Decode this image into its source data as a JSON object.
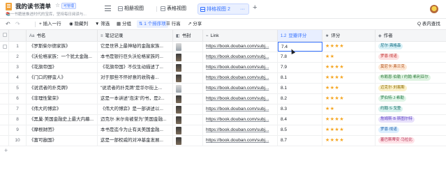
{
  "header": {
    "title": "我的读书清单",
    "star_icon": "star-outline-icon",
    "badge": "可管理",
    "subtitle": "📚一书籍是推进时代的宝库，坚持每日阅读与..."
  },
  "tabs": [
    {
      "label": "相册视图",
      "icon": "table-view-icon"
    },
    {
      "label": "表格视图",
      "icon": "table-view-icon"
    },
    {
      "label": "排格视图 2",
      "icon": "table-view-icon",
      "active": true,
      "more": "···"
    }
  ],
  "add_tab": "+",
  "toolbar": {
    "undo": "↶",
    "redo": "↷",
    "add_row": "+ 插入一行",
    "hide_cols": "◉ 隐藏列",
    "filter": "▼ 筛选",
    "group": "▦ 分组",
    "sort": "⇅ 1 个排序项",
    "row_height": "☰ 行高",
    "share": "↗ 分享",
    "search": "Q 表内查找"
  },
  "columns": {
    "book": {
      "icon": "Aa",
      "label": "书名"
    },
    "note": {
      "icon": "≡",
      "label": "笔记记录"
    },
    "cover": {
      "icon": "◧",
      "label": "书封"
    },
    "link": {
      "icon": "⌁",
      "label": "Link"
    },
    "score": {
      "icon": "1.2",
      "label": "豆瓣评分"
    },
    "rating": {
      "icon": "★",
      "label": "评分"
    },
    "author": {
      "icon": "◈",
      "label": "作者"
    }
  },
  "rows": [
    {
      "idx": "1",
      "book": "《罗斯柴尔德家族》",
      "note": "它是世界上最神秘的金融家族...",
      "link": "https://book.douban.com/subj...",
      "score": "7.4",
      "stars": "★★★★",
      "author": "尼尔·弗格森"
    },
    {
      "idx": "2",
      "book": "《沃伦格家族：一个犹太金融...",
      "note": "本书是银行巨头沃伦格家族的...",
      "link": "https://book.douban.com/subj...",
      "score": "7.8",
      "stars": "★★",
      "author": "罗恩·彻诺"
    },
    {
      "idx": "3",
      "book": "《花旗帝国》",
      "note": "《花旗帝国》不仅生动描述了...",
      "link": "https://book.douban.com/subj...",
      "score": "7.9",
      "stars": "★★★★",
      "author": "莫尼卡·弗兰克"
    },
    {
      "idx": "4",
      "book": "《门口的野蛮人》",
      "note": "对于那些不怀好意的收购者...",
      "link": "https://book.douban.com/subj...",
      "score": "8.1",
      "stars": "★★★★",
      "author": "布赖恩·伯勒 / 约翰·希利亚尔"
    },
    {
      "idx": "5",
      "book": "《说谎者的扑克牌》",
      "note": "\"说谎者的扑克牌\"是华尔街上...",
      "link": "https://book.douban.com/subj...",
      "score": "8.1",
      "stars": "★★★",
      "author": "迈克尔·刘易斯"
    },
    {
      "idx": "6",
      "book": "《非理性繁荣》",
      "note": "这是一本讲述\"泡沫\"的书，是2...",
      "link": "https://book.douban.com/subj...",
      "score": "8.2",
      "stars": "★★★★",
      "author": "罗伯特·J·希勒"
    },
    {
      "idx": "7",
      "book": "《伟大的博弈》",
      "note": "《伟大的博弈》是一部讲述以...",
      "link": "https://book.douban.com/subj...",
      "score": "8.3",
      "stars": "★★",
      "author": "约翰·S·戈登"
    },
    {
      "idx": "8",
      "book": "《黑巢·美国金融史上最大内幕...",
      "note": "迈克尔·米尔肯被誉为\"美国金融...",
      "link": "https://book.douban.com/subj...",
      "score": "8.4",
      "stars": "★★★★",
      "author": "詹姆斯·B·斯图尔特"
    },
    {
      "idx": "9",
      "book": "《摩根财团》",
      "note": "本书是迄今为止有关美国金融...",
      "link": "https://book.douban.com/subj...",
      "score": "8.5",
      "stars": "★★★★",
      "author": "罗恩·彻诺"
    },
    {
      "idx": "10",
      "book": "《富可敌国》",
      "note": "这是一部权威的对冲基金发展...",
      "link": "https://book.douban.com/subj...",
      "score": "8.7",
      "stars": "★★★★",
      "author": "塞巴斯蒂安·马拉比"
    }
  ],
  "add_row": "+",
  "colors": {
    "accent": "#3370ff",
    "star": "#f5a623"
  }
}
